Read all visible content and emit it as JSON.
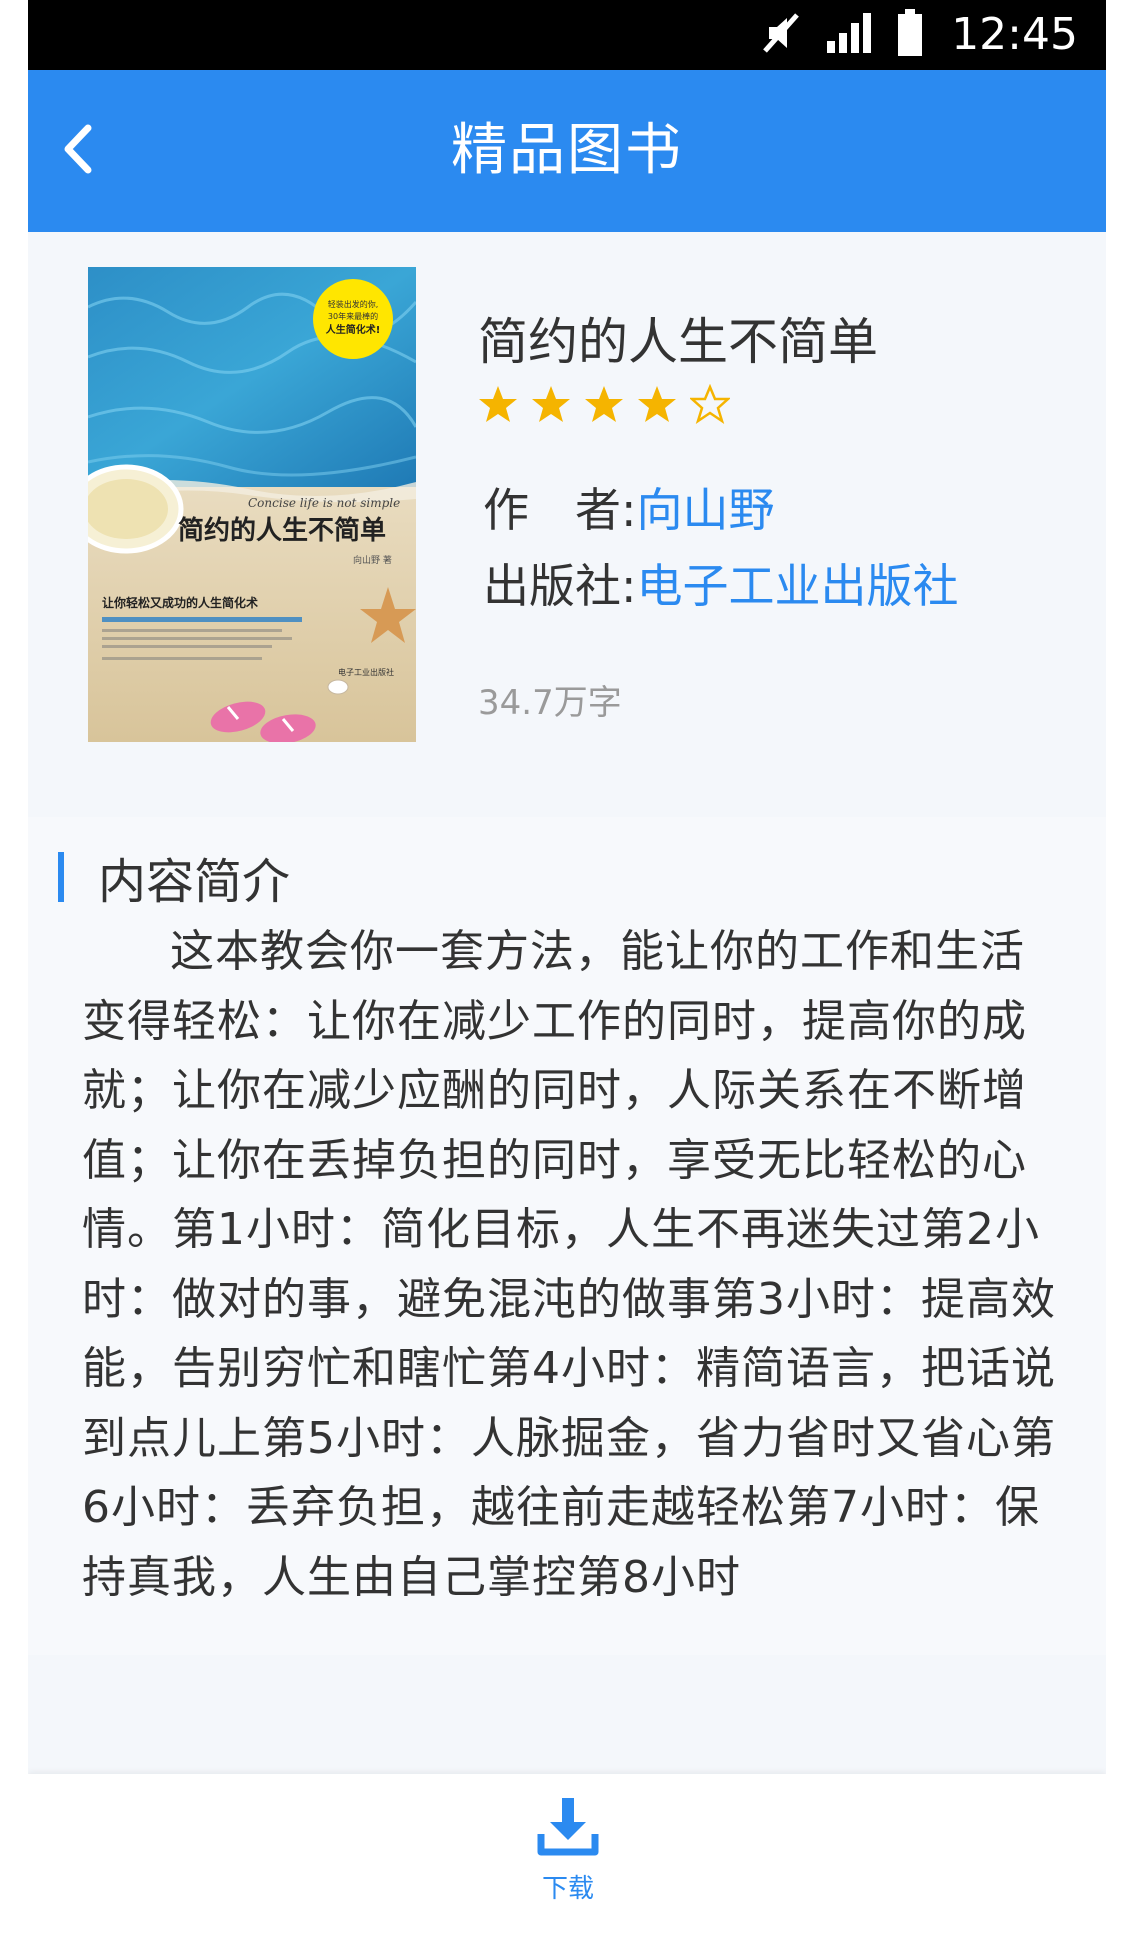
{
  "status_bar": {
    "time": "12:45",
    "icons": [
      "mute-icon",
      "signal-icon",
      "battery-icon"
    ]
  },
  "header": {
    "back_icon": "chevron-left-icon",
    "title": "精品图书"
  },
  "book": {
    "title": "简约的人生不简单",
    "rating": 4,
    "rating_max": 5,
    "author_label": "作　者:",
    "author": "向山野",
    "publisher_label": "出版社:",
    "publisher": "电子工业出版社",
    "word_count": "34.7万字",
    "cover": {
      "badge_line1": "轻装出发的你,",
      "badge_line2": "30年来最棒的",
      "badge_line3": "人生简化术!",
      "english_title": "Concise life is not simple",
      "title": "简约的人生不简单",
      "author": "向山野 著",
      "tagline": "让你轻松又成功的人生简化术",
      "publisher_mark": "电子工业出版社"
    }
  },
  "intro": {
    "heading": "内容简介",
    "body": "这本教会你一套方法，能让你的工作和生活变得轻松：让你在减少工作的同时，提高你的成就；让你在减少应酬的同时，人际关系在不断增值；让你在丢掉负担的同时，享受无比轻松的心情。第1小时：简化目标，人生不再迷失过第2小时：做对的事，避免混沌的做事第3小时：提高效能，告别穷忙和瞎忙第4小时：精简语言，把话说到点儿上第5小时：人脉掘金，省力省时又省心第6小时：丢弃负担，越往前走越轻松第7小时：保持真我，人生由自己掌控第8小时"
  },
  "bottom_bar": {
    "download_icon": "download-icon",
    "download_label": "下载"
  },
  "colors": {
    "accent": "#2b8af0",
    "star": "#f5b400",
    "text": "#333333",
    "muted": "#9a9a9a"
  }
}
